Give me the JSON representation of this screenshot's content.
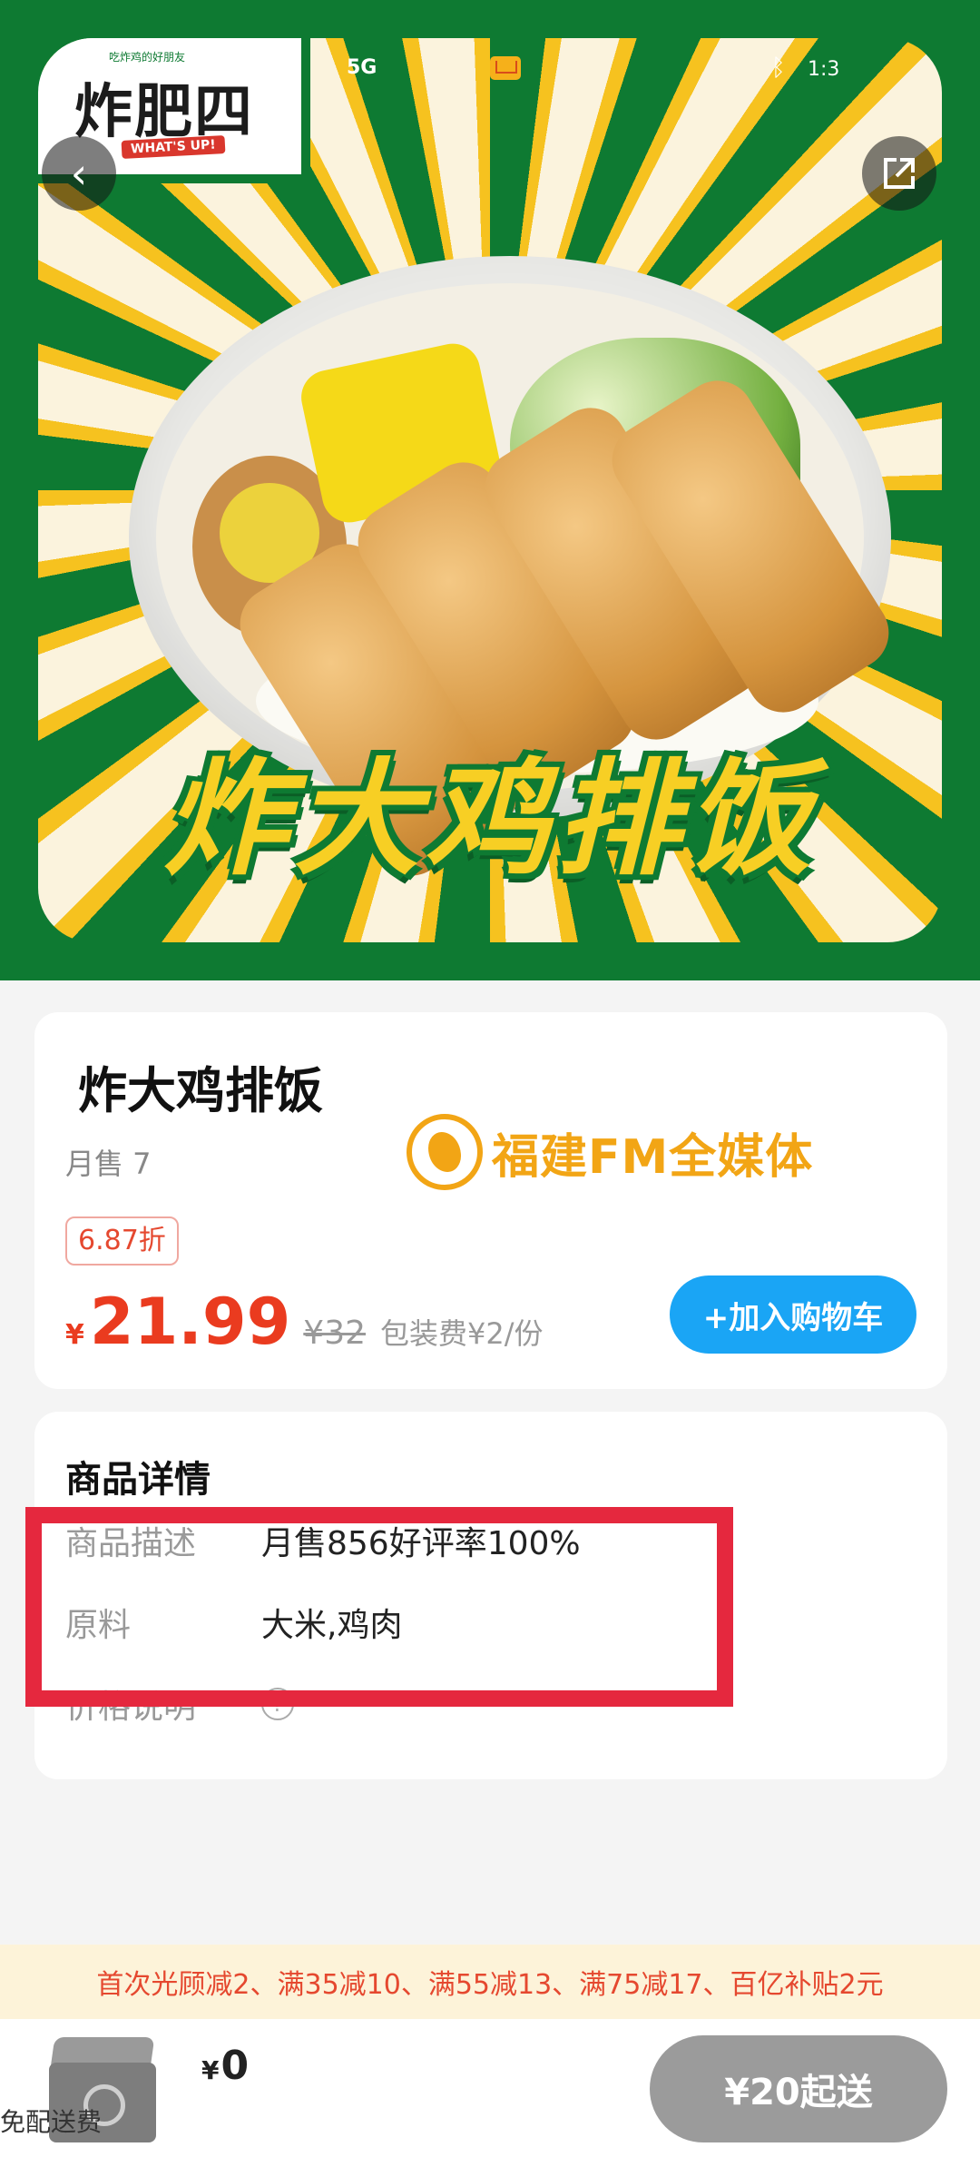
{
  "status_bar": {
    "signal": "5G",
    "time": "1:3"
  },
  "hero": {
    "brand_logo": "炸肥四",
    "brand_tag": "吃炸鸡的好朋友",
    "brand_sub": "WHAT'S UP!",
    "dish_title": "炸大鸡排饭",
    "colors": {
      "green": "#0e7a32",
      "yellow": "#f6c21f"
    }
  },
  "product": {
    "name": "炸大鸡排饭",
    "monthly_sales": "月售 7",
    "watermark": "福建FM全媒体",
    "discount": "6.87折",
    "currency": "¥",
    "price": "21.99",
    "original_price": "¥32",
    "packaging_fee": "包装费¥2/份",
    "add_to_cart": "+加入购物车",
    "accent_color": "#1aa5f5",
    "price_color": "#ea3b1f"
  },
  "details": {
    "title": "商品详情",
    "rows": [
      {
        "label": "商品描述",
        "value": "月售856好评率100%"
      },
      {
        "label": "原料",
        "value": "大米,鸡肉"
      },
      {
        "label": "价格说明",
        "value": "?"
      }
    ]
  },
  "promo": {
    "text": "首次光顾减2、满35减10、满55减13、满75减17、百亿补贴2元"
  },
  "bottom_bar": {
    "currency": "¥",
    "total": "0",
    "delivery_fee": "免配送费",
    "min_order": "¥20起送"
  }
}
